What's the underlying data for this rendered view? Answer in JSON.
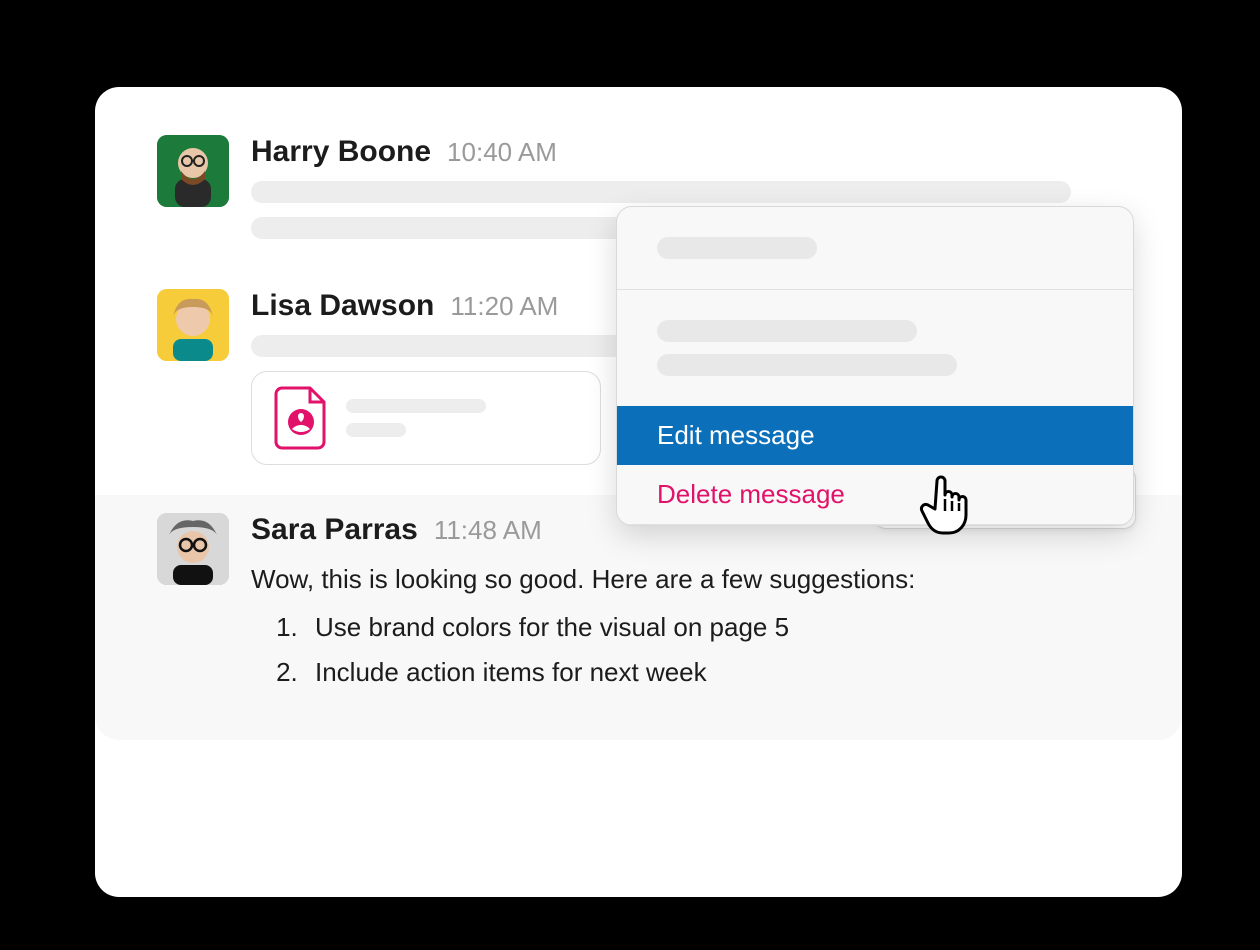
{
  "messages": [
    {
      "author": "Harry Boone",
      "time": "10:40 AM"
    },
    {
      "author": "Lisa Dawson",
      "time": "11:20 AM"
    },
    {
      "author": "Sara Parras",
      "time": "11:48 AM",
      "text": "Wow, this is looking so good. Here are a few suggestions:",
      "list": [
        "Use brand colors for the visual on page 5",
        "Include action items for next week"
      ]
    }
  ],
  "context_menu": {
    "edit": "Edit message",
    "delete": "Delete message"
  },
  "colors": {
    "edit_bg": "#0b6fba",
    "delete_fg": "#e2116a"
  }
}
